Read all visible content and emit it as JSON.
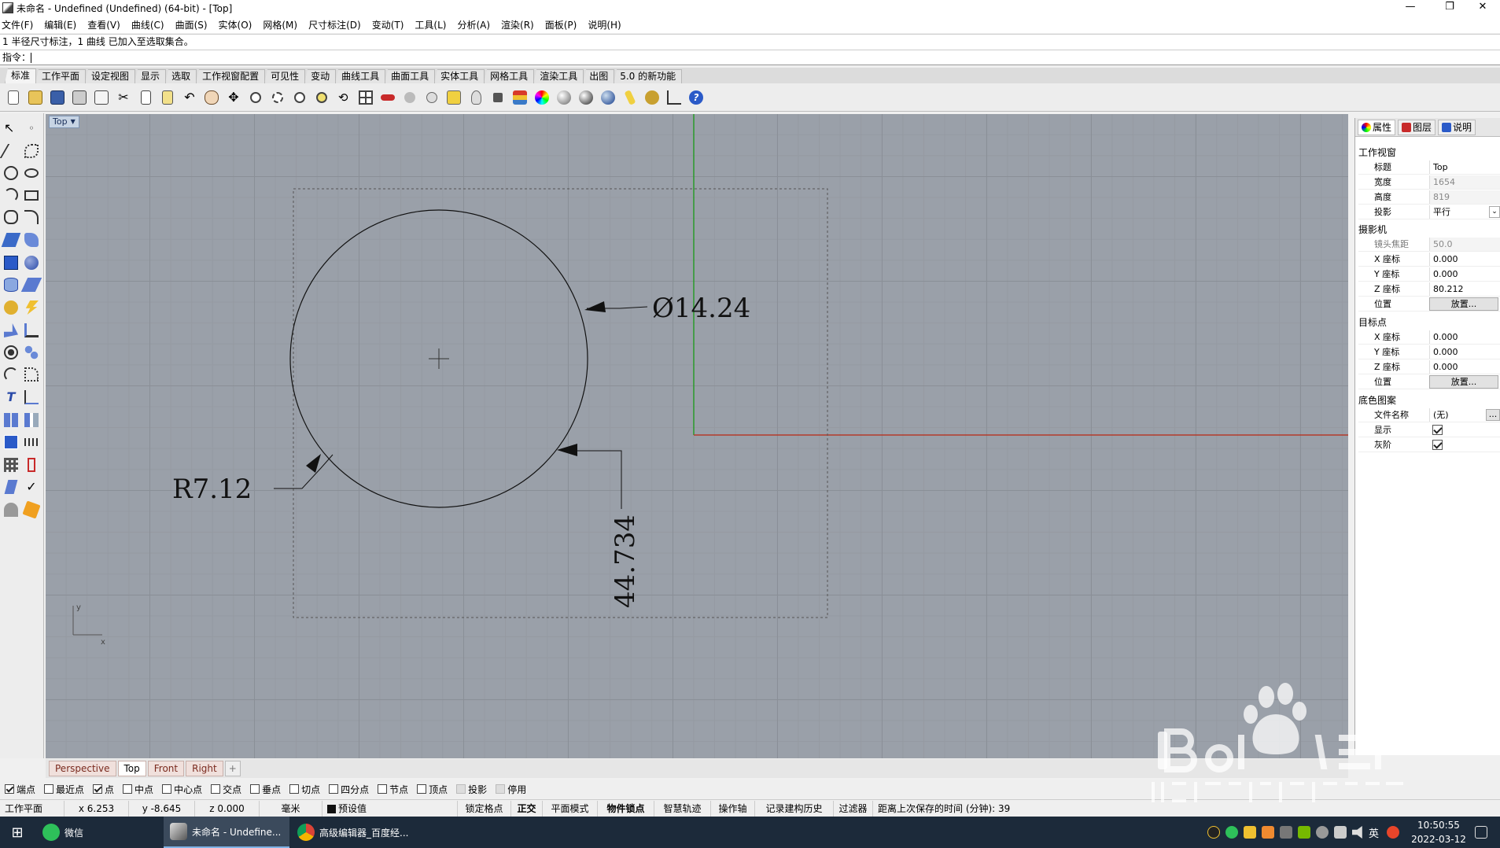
{
  "window": {
    "title": "未命名 - Undefined (Undefined) (64-bit) - [Top]",
    "minimize": "—",
    "restore": "❐",
    "close": "✕"
  },
  "menu": [
    "文件(F)",
    "编辑(E)",
    "查看(V)",
    "曲线(C)",
    "曲面(S)",
    "实体(O)",
    "网格(M)",
    "尺寸标注(D)",
    "变动(T)",
    "工具(L)",
    "分析(A)",
    "渲染(R)",
    "面板(P)",
    "说明(H)"
  ],
  "command": {
    "history": "1 半径尺寸标注，1 曲线 已加入至选取集合。",
    "prompt": "指令：",
    "value": ""
  },
  "toolbar_tabs": [
    "标准",
    "工作平面",
    "设定视图",
    "显示",
    "选取",
    "工作视窗配置",
    "可见性",
    "变动",
    "曲线工具",
    "曲面工具",
    "实体工具",
    "网格工具",
    "渲染工具",
    "出图",
    "5.0 的新功能"
  ],
  "viewport": {
    "label": "Top",
    "dims": {
      "diameter": "Ø14.24",
      "radius": "R7.12",
      "linear": "44.734"
    },
    "axis_x": "x",
    "axis_y": "y"
  },
  "view_tabs": [
    "Perspective",
    "Top",
    "Front",
    "Right"
  ],
  "view_tabs_add": "+",
  "panel": {
    "tabs": [
      "属性",
      "图层",
      "说明"
    ],
    "sections": {
      "viewport": "工作视窗",
      "camera": "摄影机",
      "target": "目标点",
      "wallpaper": "底色图案"
    },
    "rows": {
      "title_k": "标题",
      "title_v": "Top",
      "width_k": "宽度",
      "width_v": "1654",
      "height_k": "高度",
      "height_v": "819",
      "proj_k": "投影",
      "proj_v": "平行",
      "focal_k": "镜头焦距",
      "focal_v": "50.0",
      "cx_k": "X 座标",
      "cx_v": "0.000",
      "cy_k": "Y 座标",
      "cy_v": "0.000",
      "cz_k": "Z 座标",
      "cz_v": "80.212",
      "cpos_k": "位置",
      "cpos_btn": "放置...",
      "tx_k": "X 座标",
      "tx_v": "0.000",
      "ty_k": "Y 座标",
      "ty_v": "0.000",
      "tz_k": "Z 座标",
      "tz_v": "0.000",
      "tpos_k": "位置",
      "tpos_btn": "放置...",
      "file_k": "文件名称",
      "file_v": "(无)",
      "file_btn": "...",
      "show_k": "显示",
      "gray_k": "灰阶"
    }
  },
  "osnap": [
    {
      "label": "端点",
      "checked": true
    },
    {
      "label": "最近点",
      "checked": false
    },
    {
      "label": "点",
      "checked": true
    },
    {
      "label": "中点",
      "checked": false
    },
    {
      "label": "中心点",
      "checked": false
    },
    {
      "label": "交点",
      "checked": false
    },
    {
      "label": "垂点",
      "checked": false
    },
    {
      "label": "切点",
      "checked": false
    },
    {
      "label": "四分点",
      "checked": false
    },
    {
      "label": "节点",
      "checked": false
    },
    {
      "label": "顶点",
      "checked": false
    },
    {
      "label": "投影",
      "checked": false,
      "disabled": true
    },
    {
      "label": "停用",
      "checked": false,
      "disabled": true
    }
  ],
  "status": {
    "cplane": "工作平面",
    "x": "x 6.253",
    "y": "y -8.645",
    "z": "z 0.000",
    "unit": "毫米",
    "layer": "预设值",
    "grid_snap": "锁定格点",
    "ortho": "正交",
    "planar": "平面模式",
    "osnap": "物件锁点",
    "smarttrack": "智慧轨迹",
    "gumball": "操作轴",
    "history": "记录建构历史",
    "filter": "过滤器",
    "autosave": "距离上次保存的时间 (分钟): 39"
  },
  "taskbar": {
    "start": "⊞",
    "apps": [
      "微信",
      "未命名 - Undefine...",
      "高级编辑器_百度经..."
    ],
    "ime": "英",
    "time": "10:50:55",
    "date": "2022-03-12"
  },
  "colors": {
    "viewport_bg": "#9aa0a9",
    "axis_x": "#b33a2a",
    "axis_y": "#2a9a2a",
    "taskbar": "#1c2a3a"
  }
}
